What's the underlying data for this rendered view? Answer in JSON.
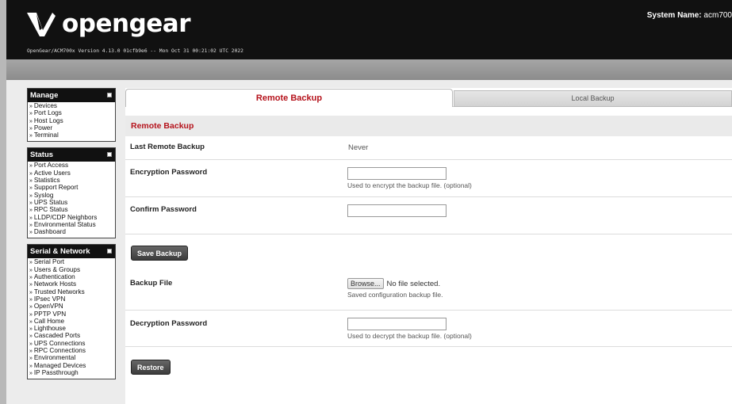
{
  "header": {
    "logo_text": "opengear",
    "version": "OpenGear/ACM700x Version 4.13.0 01cfb9e6 -- Mon Oct 31 00:21:02 UTC 2022",
    "system_name_label": "System Name:",
    "system_name_value": "acm700"
  },
  "sidebar": {
    "manage": {
      "title": "Manage",
      "items": [
        "Devices",
        "Port Logs",
        "Host Logs",
        "Power",
        "Terminal"
      ]
    },
    "status": {
      "title": "Status",
      "items": [
        "Port Access",
        "Active Users",
        "Statistics",
        "Support Report",
        "Syslog",
        "UPS Status",
        "RPC Status",
        "LLDP/CDP Neighbors",
        "Environmental Status",
        "Dashboard"
      ]
    },
    "serial_network": {
      "title": "Serial & Network",
      "items": [
        "Serial Port",
        "Users & Groups",
        "Authentication",
        "Network Hosts",
        "Trusted Networks",
        "IPsec VPN",
        "OpenVPN",
        "PPTP VPN",
        "Call Home",
        "Lighthouse",
        "Cascaded Ports",
        "UPS Connections",
        "RPC Connections",
        "Environmental",
        "Managed Devices",
        "IP Passthrough"
      ]
    }
  },
  "tabs": {
    "remote": "Remote Backup",
    "local": "Local Backup"
  },
  "form": {
    "section_title": "Remote Backup",
    "last_backup_label": "Last Remote Backup",
    "last_backup_value": "Never",
    "enc_label": "Encryption Password",
    "enc_value": "",
    "enc_hint": "Used to encrypt the backup file. (optional)",
    "confirm_label": "Confirm Password",
    "confirm_value": "",
    "save_button": "Save Backup",
    "file_label": "Backup File",
    "browse_button": "Browse...",
    "file_status": "No file selected.",
    "file_hint": "Saved configuration backup file.",
    "dec_label": "Decryption Password",
    "dec_value": "",
    "dec_hint": "Used to decrypt the backup file. (optional)",
    "restore_button": "Restore"
  },
  "colors": {
    "accent_red": "#b5121b",
    "header_bg": "#111111"
  }
}
